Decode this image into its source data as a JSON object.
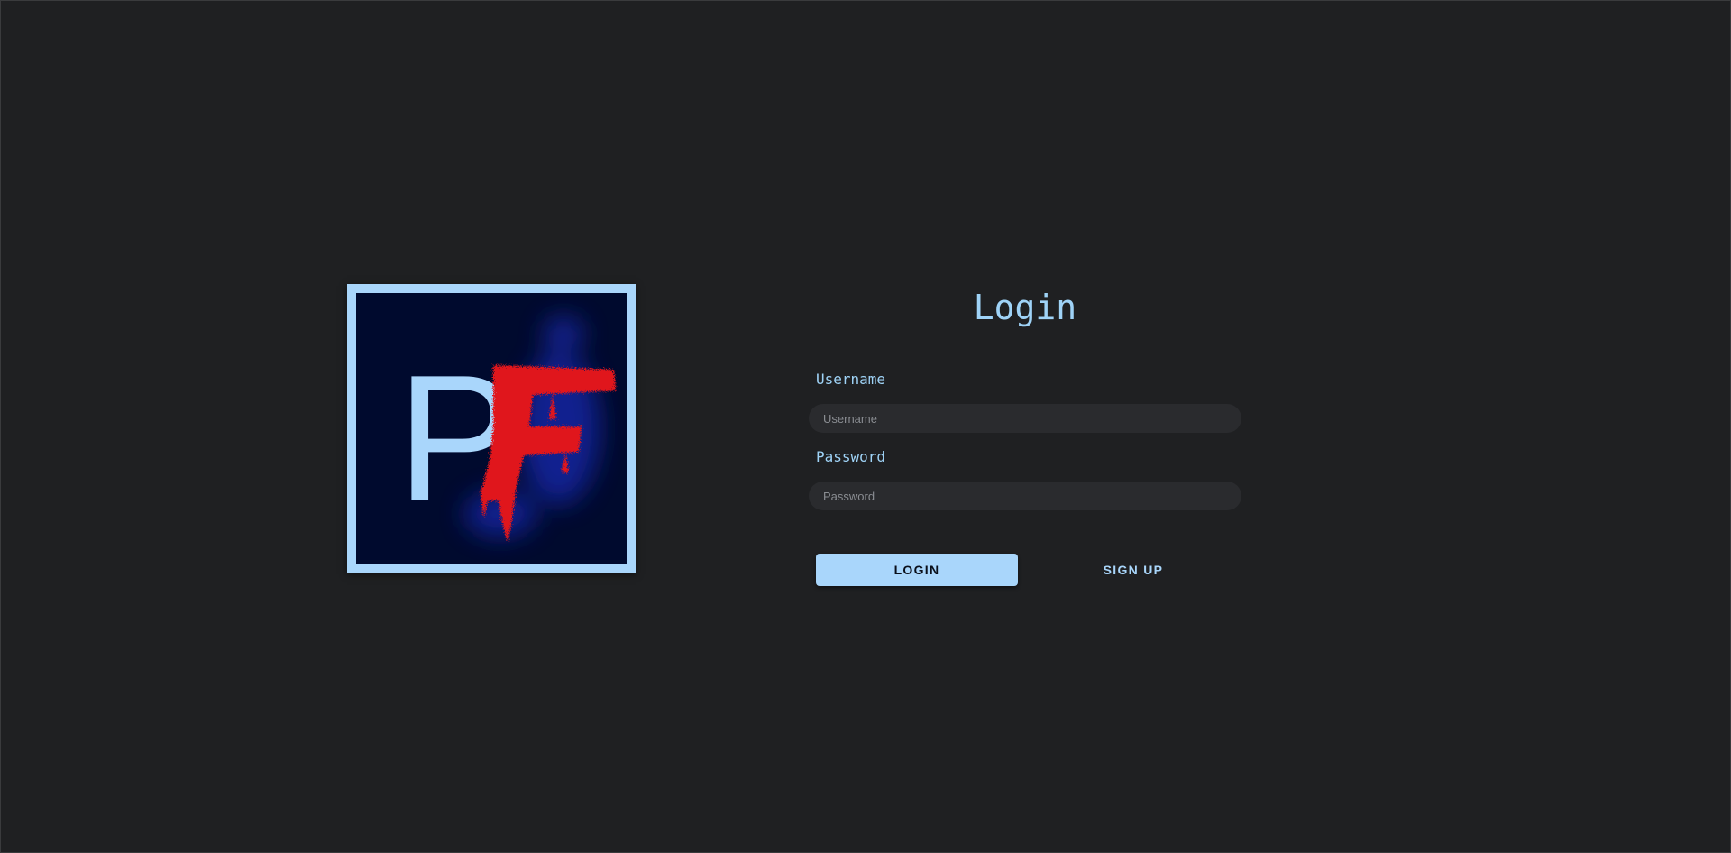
{
  "logo": {
    "letters": [
      "P",
      "F"
    ],
    "colors": {
      "frame": "#a9d6fb",
      "background": "#000a2e",
      "letter_p": "#a9d6fb",
      "letter_f": "#e0151a",
      "glow": "#1a2bb0"
    }
  },
  "login": {
    "title": "Login",
    "username_label": "Username",
    "username_placeholder": "Username",
    "username_value": "",
    "password_label": "Password",
    "password_placeholder": "Password",
    "password_value": "",
    "login_button": "LOGIN",
    "signup_button": "SIGN UP"
  },
  "theme": {
    "background": "#1f2022",
    "accent": "#a9d6fb",
    "input_background": "#2a2b2e"
  }
}
